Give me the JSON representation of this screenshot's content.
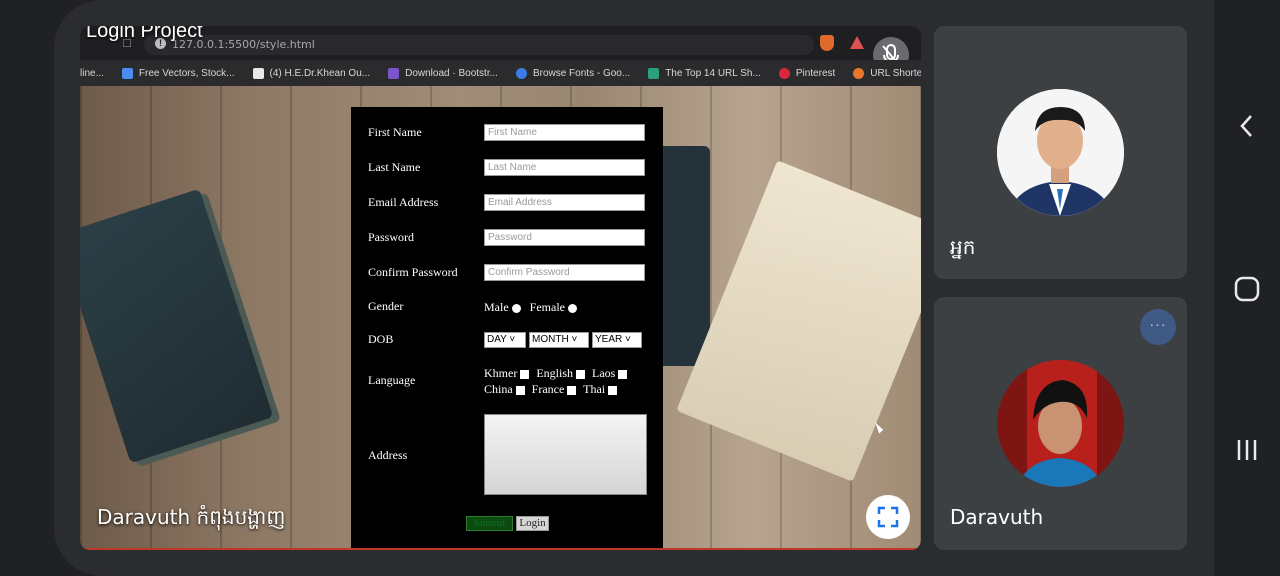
{
  "window": {
    "title": "Login Project",
    "url": "127.0.0.1:5500/style.html",
    "presenter_label": "Daravuth កំពុងបង្ហាញ"
  },
  "bookmarks": [
    {
      "label": "line...",
      "color": "#777777"
    },
    {
      "label": "Free Vectors, Stock...",
      "color": "#4a8cf0"
    },
    {
      "label": "(4) H.E.Dr.Khean Ou...",
      "color": "#e8e8e8"
    },
    {
      "label": "Download · Bootstr...",
      "color": "#7a55c9"
    },
    {
      "label": "Browse Fonts - Goo...",
      "color": "#3b7be8"
    },
    {
      "label": "The Top 14 URL Sh...",
      "color": "#2aa17a"
    },
    {
      "label": "Pinterest",
      "color": "#d8283c"
    },
    {
      "label": "URL Shortener - Sh...",
      "color": "#e8762b"
    }
  ],
  "form": {
    "fields": [
      {
        "label": "First Name",
        "placeholder": "First Name"
      },
      {
        "label": "Last Name",
        "placeholder": "Last Name"
      },
      {
        "label": "Email Address",
        "placeholder": "Email Address"
      },
      {
        "label": "Password",
        "placeholder": "Password"
      },
      {
        "label": "Confirm Password",
        "placeholder": "Confirm Password"
      }
    ],
    "gender": {
      "label": "Gender",
      "options": [
        "Male",
        "Female"
      ]
    },
    "dob": {
      "label": "DOB",
      "day": "DAY",
      "month": "MONTH",
      "year": "YEAR"
    },
    "language": {
      "label": "Language",
      "options": [
        "Khmer",
        "English",
        "Laos",
        "China",
        "France",
        "Thai"
      ]
    },
    "address": {
      "label": "Address"
    },
    "submit_label": "Submit",
    "login_label": "Login"
  },
  "participants": [
    {
      "name": "អ្នក"
    },
    {
      "name": "Daravuth"
    }
  ],
  "colors": {
    "background": "#202124",
    "tile": "#3c4043",
    "more_button": "#3f5a85",
    "share_indicator": "#c0392b"
  },
  "icons": [
    "star-icon",
    "info-icon",
    "mute-icon",
    "fullscreen-icon",
    "more-icon",
    "back-icon",
    "home-icon",
    "recents-icon"
  ]
}
